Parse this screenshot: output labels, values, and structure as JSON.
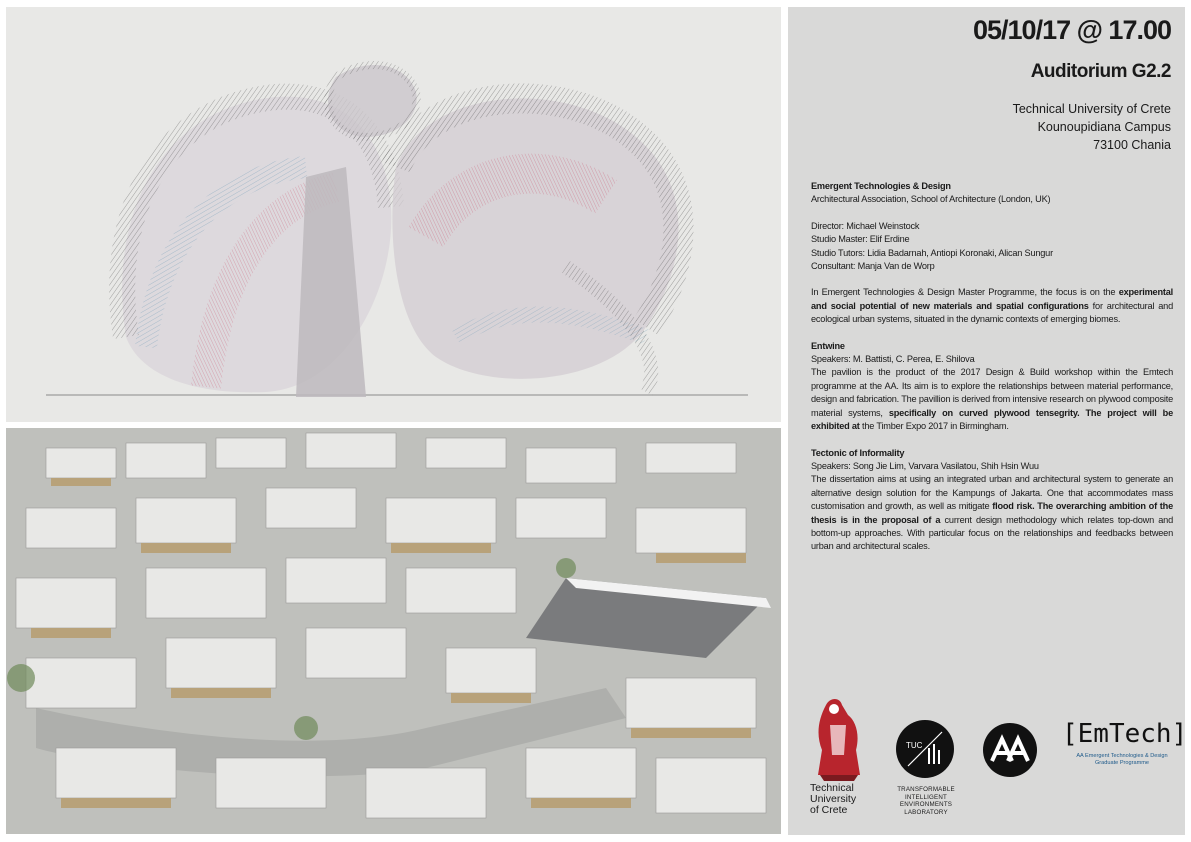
{
  "header": {
    "date_time": "05/10/17 @ 17.00",
    "room": "Auditorium G2.2",
    "address": [
      "Technical University of Crete",
      "Kounoupidiana Campus",
      "73100 Chania"
    ]
  },
  "programme": {
    "title": "Emergent Technologies & Design",
    "institution": "Architectural Association, School of Architecture (London, UK)",
    "director": "Director: Michael Weinstock",
    "studio_master": "Studio Master: Elif Erdine",
    "studio_tutors": "Studio Tutors: Lidia Badarnah, Antiopi Koronaki, Alican Sungur",
    "consultant": "Consultant: Manja Van de Worp",
    "intro_1": "In Emergent Technologies & Design Master Programme, the focus is on the ",
    "intro_bold": "experimental and social potential of new materials and spatial configurations",
    "intro_2": " for architectural and ecological urban systems, situated in the dynamic contexts of emerging biomes."
  },
  "entwine": {
    "title": "Entwine",
    "speakers": "Speakers: M. Battisti, C. Perea, E. Shilova",
    "text_1": "The pavilion is the product of the 2017 Design & Build workshop within the Emtech programme at the AA. Its aim is to explore the relationships between material performance, design and fabrication. The pavillion is derived from intensive research on plywood composite material systems, ",
    "text_bold": "specifically on curved plywood tensegrity. The project will be exhibited at",
    "text_2": " the Timber Expo 2017 in Birmingham."
  },
  "tectonic": {
    "title": "Tectonic of Informality",
    "speakers": "Speakers:  Song Jie Lim, Varvara Vasilatou, Shih Hsin Wuu",
    "text_1": "The dissertation aims at using an integrated urban and architectural system to generate an alternative design solution for the Kampungs of Jakarta. One that accommodates mass customisation and growth, as well as mitigate ",
    "text_bold": "flood risk. The overarching ambition of the thesis is in the proposal of a",
    "text_2": " current design methodology which relates  top-down and bottom-up approaches. With particular focus on the relationships and feedbacks between urban and architectural scales."
  },
  "logos": {
    "tuc_name": [
      "Technical",
      "University",
      "of Crete"
    ],
    "tile_mark": "TUC",
    "tile_name": [
      "TRANSFORMABLE",
      "INTELLIGENT",
      "ENVIRONMENTS",
      "LABORATORY"
    ],
    "aa_mark": "AA",
    "emtech_mark": "[EmTech]",
    "emtech_sub": [
      "AA Emergent Technologies & Design",
      "Graduate Programme"
    ]
  },
  "colors": {
    "panel_bg": "#d9d9d8",
    "emtech_blue": "#1e5a8a",
    "tuc_red": "#b8252d"
  }
}
